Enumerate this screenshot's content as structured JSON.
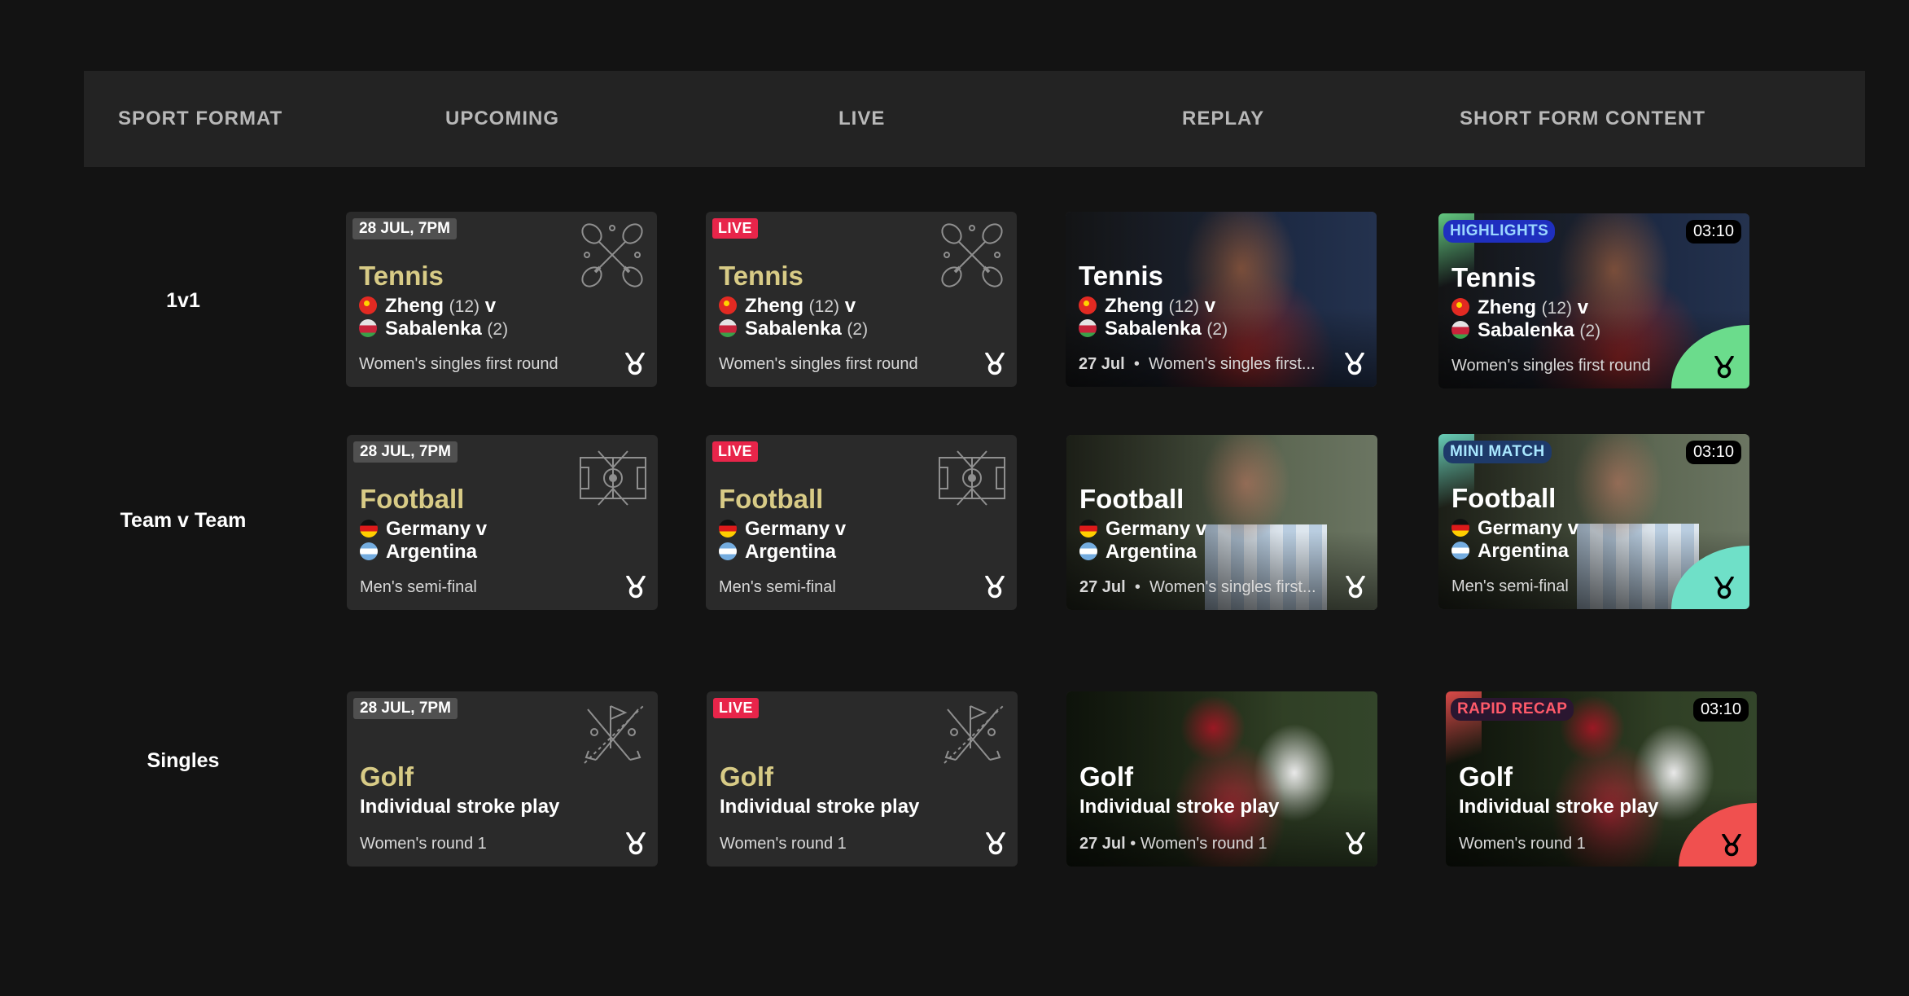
{
  "header": {
    "sport_format": "SPORT FORMAT",
    "upcoming": "UPCOMING",
    "live": "LIVE",
    "replay": "REPLAY",
    "short_form": "SHORT FORM CONTENT"
  },
  "rows": {
    "r1": "1v1",
    "r2": "Team v Team",
    "r3": "Singles"
  },
  "tennis": {
    "date": "28 JUL, 7PM",
    "live": "LIVE",
    "sport": "Tennis",
    "p1": "Zheng",
    "p1_seed": "(12)",
    "vs": "v",
    "p2": "Sabalenka",
    "p2_seed": "(2)",
    "sub": "Women's singles first round",
    "replay_date": "27 Jul",
    "replay_sub": "Women's singles first...",
    "cat": "HIGHLIGHTS",
    "dur": "03:10"
  },
  "football": {
    "date": "28 JUL, 7PM",
    "live": "LIVE",
    "sport": "Football",
    "t1": "Germany",
    "vs": "v",
    "t2": "Argentina",
    "sub": "Men's semi-final",
    "replay_date": "27 Jul",
    "replay_sub": "Women's singles first...",
    "cat": "MINI MATCH",
    "dur": "03:10"
  },
  "golf": {
    "date": "28 JUL, 7PM",
    "live": "LIVE",
    "sport": "Golf",
    "event": "Individual stroke play",
    "sub": "Women's round 1",
    "replay_date": "27 Jul",
    "cat": "RAPID RECAP",
    "dur": "03:10"
  },
  "separator": "•",
  "colors": {
    "background": "#131313",
    "header": "#232323",
    "card": "#2a2a2a",
    "sport_title": "#d8cb86",
    "live_badge": "#e8254a",
    "highlights": "#6bdc8c",
    "mini_match": "#6fe0c8",
    "rapid_recap": "#f0504f"
  },
  "icons": [
    "tennis-rackets-icon",
    "football-pitch-icon",
    "golf-clubs-icon",
    "olympic-medal-icon",
    "flag-china-icon",
    "flag-belarus-icon",
    "flag-germany-icon",
    "flag-argentina-icon"
  ]
}
